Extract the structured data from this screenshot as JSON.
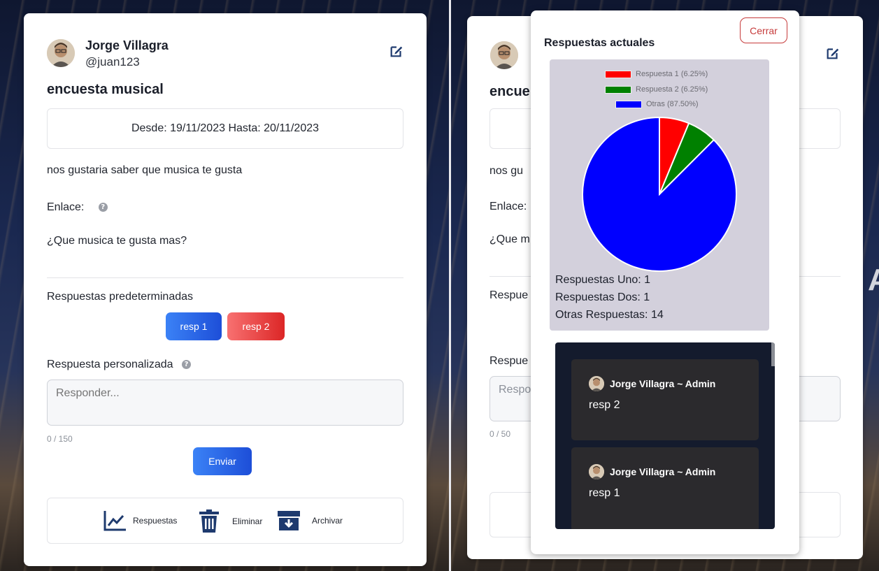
{
  "left": {
    "user_name": "Jorge Villagra",
    "handle": "@juan123",
    "survey_title": "encuesta musical",
    "date_range": "Desde: 19/11/2023 Hasta: 20/11/2023",
    "description": "nos gustaria saber que musica te gusta",
    "link_label": "Enlace:",
    "question": "¿Que musica te gusta mas?",
    "predefined_label": "Respuestas predeterminadas",
    "options": [
      "resp 1",
      "resp 2"
    ],
    "custom_label": "Respuesta personalizada",
    "placeholder": "Responder...",
    "counter": "0 / 150",
    "send_label": "Enviar",
    "actions": {
      "responses": "Respuestas",
      "delete": "Eliminar",
      "archive": "Archivar"
    }
  },
  "right": {
    "partial_title": "encue",
    "partial_description": "nos gu",
    "partial_link": "Enlace:",
    "partial_question": "¿Que m",
    "partial_predefined": "Respue",
    "partial_custom": "Respue",
    "partial_placeholder": "Respo",
    "counter": "0 / 50"
  },
  "modal": {
    "title": "Respuestas actuales",
    "close_label": "Cerrar",
    "legend": [
      {
        "label": "Respuesta 1 (6.25%)",
        "color": "#ff0000"
      },
      {
        "label": "Respuesta 2 (6.25%)",
        "color": "#008000"
      },
      {
        "label": "Otras (87.50%)",
        "color": "#0000ff"
      }
    ],
    "counts": {
      "one": "Respuestas Uno: 1",
      "two": "Respuestas Dos: 1",
      "other": "Otras Respuestas: 14"
    },
    "messages": [
      {
        "author": "Jorge Villagra ~ Admin",
        "text": "resp 2"
      },
      {
        "author": "Jorge Villagra ~ Admin",
        "text": "resp 1"
      }
    ]
  },
  "chart_data": {
    "type": "pie",
    "categories": [
      "Respuesta 1",
      "Respuesta 2",
      "Otras"
    ],
    "values": [
      6.25,
      6.25,
      87.5
    ],
    "colors": [
      "#ff0000",
      "#008000",
      "#0000ff"
    ],
    "legend_position": "top"
  },
  "colors": {
    "primary_blue": "#1d4ed8",
    "danger_red": "#dc2626",
    "chat_bg": "#141b2d",
    "chart_bg": "#d3d0dc"
  }
}
